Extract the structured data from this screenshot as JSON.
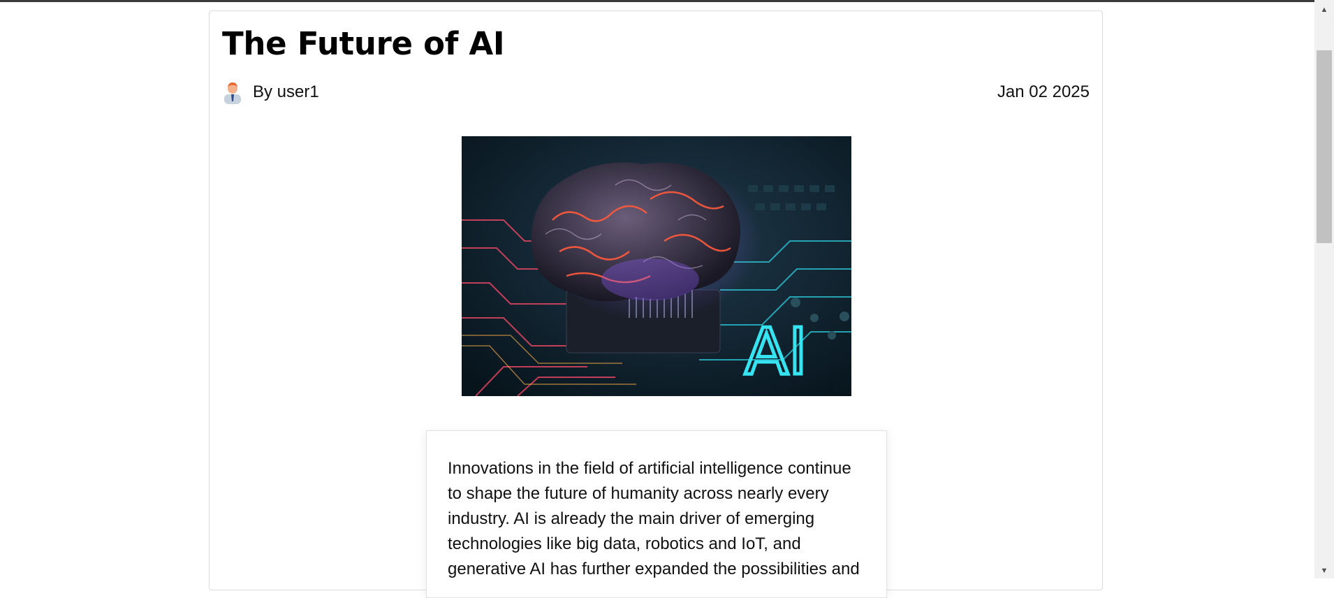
{
  "article": {
    "title": "The Future of AI",
    "author": "By user1",
    "date": "Jan 02 2025",
    "image_text": "AI",
    "excerpt": "Innovations in the field of artificial intelligence continue to shape the future of humanity across nearly every industry. AI is already the main driver of emerging technologies like big data, robotics and IoT, and generative AI has further expanded the possibilities and"
  },
  "icons": {
    "avatar": "user-avatar-icon",
    "scroll_up": "arrow-up-icon",
    "scroll_down": "arrow-down-icon"
  },
  "colors": {
    "accent_cyan": "#36e3f0",
    "accent_red": "#ff4a3d",
    "scroll_thumb": "#c1c1c1"
  }
}
